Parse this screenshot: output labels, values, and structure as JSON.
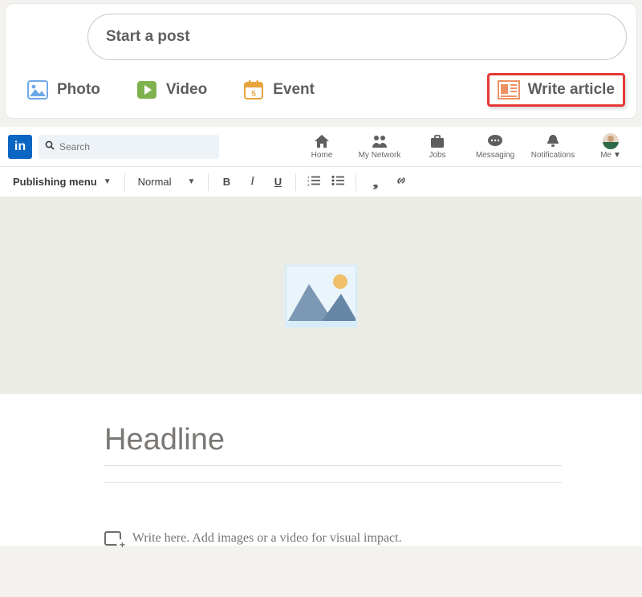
{
  "share": {
    "start_placeholder": "Start a post",
    "actions": {
      "photo": "Photo",
      "video": "Video",
      "event": "Event",
      "write_article": "Write article"
    },
    "event_day": "5"
  },
  "topnav": {
    "logo": "in",
    "search_placeholder": "Search",
    "items": {
      "home": "Home",
      "network": "My Network",
      "jobs": "Jobs",
      "messaging": "Messaging",
      "notifications": "Notifications",
      "me": "Me"
    }
  },
  "toolbar": {
    "menu_label": "Publishing menu",
    "style_label": "Normal"
  },
  "article": {
    "headline_placeholder": "Headline",
    "body_placeholder": "Write here. Add images or a video for visual impact."
  }
}
